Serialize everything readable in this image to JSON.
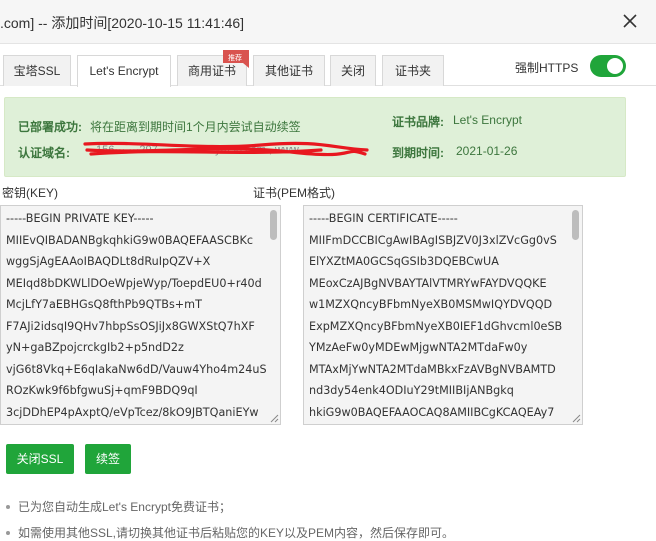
{
  "window": {
    "title": ".com] -- 添加时间[2020-10-15 11:41:46]"
  },
  "tabs": [
    {
      "label": "宝塔SSL",
      "active": false
    },
    {
      "label": "Let's Encrypt",
      "active": true
    },
    {
      "label": "商用证书",
      "active": false,
      "badge": "推荐"
    },
    {
      "label": "其他证书",
      "active": false
    },
    {
      "label": "关闭",
      "active": false
    },
    {
      "label": "证书夹",
      "active": false
    }
  ],
  "https_toggle": {
    "label": "强制HTTPS",
    "on": true
  },
  "info": {
    "deploy_label": "已部署成功:",
    "deploy_value": "将在距离到期时间1个月内尝试自动续签",
    "domain_label": "认证域名:",
    "domain_value": "···156··· ···297··· ········ ···ym56.com ,  www...",
    "brand_label": "证书品牌:",
    "brand_value": "Let's Encrypt",
    "expire_label": "到期时间:",
    "expire_value": "2021-01-26"
  },
  "key": {
    "label": "密钥(KEY)",
    "lines": [
      "-----BEGIN PRIVATE KEY-----",
      "MIIEvQIBADANBgkqhkiG9w0BAQEFAASCBKc",
      "wggSjAgEAAoIBAQDLt8dRuIpQZV+X",
      "MEIqd8bDKWLlDOeWpjeWyp/ToepdEU0+r40d",
      "McjLfY7aEBHGsQ8fthPb9QTBs+mT",
      "F7AJi2idsqI9QHv7hbpSsOSJiJx8GWXStQ7hXF",
      "yN+gaBZpojcrckgIb2+p5ndD2z",
      "vjG6t8Vkq+E6qIakaNw6dD/Vauw4Yho4m24uS",
      "ROzKwk9f6bfgwuSj+qmF9BDQ9qI",
      "3cjDDhEP4pAxptQ/eVpTcez/8kO9JBTQaniEYw"
    ]
  },
  "cert": {
    "label": "证书(PEM格式)",
    "lines": [
      "-----BEGIN CERTIFICATE-----",
      "MIIFmDCCBICgAwIBAgISBJZV0J3xlZVcGg0vS",
      "ElYXZtMA0GCSqGSIb3DQEBCwUA",
      "MEoxCzAJBgNVBAYTAlVTMRYwFAYDVQQKE",
      "w1MZXQncyBFbmNyeXB0MSMwIQYDVQQD",
      "ExpMZXQncyBFbmNyeXB0IEF1dGhvcml0eSB",
      "YMzAeFw0yMDEwMjgwNTA2MTdaFw0y",
      "MTAxMjYwNTA2MTdaMBkxFzAVBgNVBAMTD",
      "nd3dy54enk4ODIuY29tMIIBIjANBgkq",
      "hkiG9w0BAQEFAAOCAQ8AMIIBCgKCAQEAy7"
    ]
  },
  "buttons": {
    "close_ssl": "关闭SSL",
    "renew": "续签"
  },
  "tips": [
    "已为您自动生成Let's Encrypt免费证书；",
    "如需使用其他SSL,请切换其他证书后粘贴您的KEY以及PEM内容，然后保存即可。"
  ],
  "colors": {
    "accent": "#20a53a",
    "info_bg": "#dff0d8",
    "info_text": "#3c763d",
    "badge": "#d9534f",
    "redaction": "#e8171f"
  },
  "icons": {
    "close": "close-icon",
    "ribbon": "recommend-ribbon-icon"
  }
}
